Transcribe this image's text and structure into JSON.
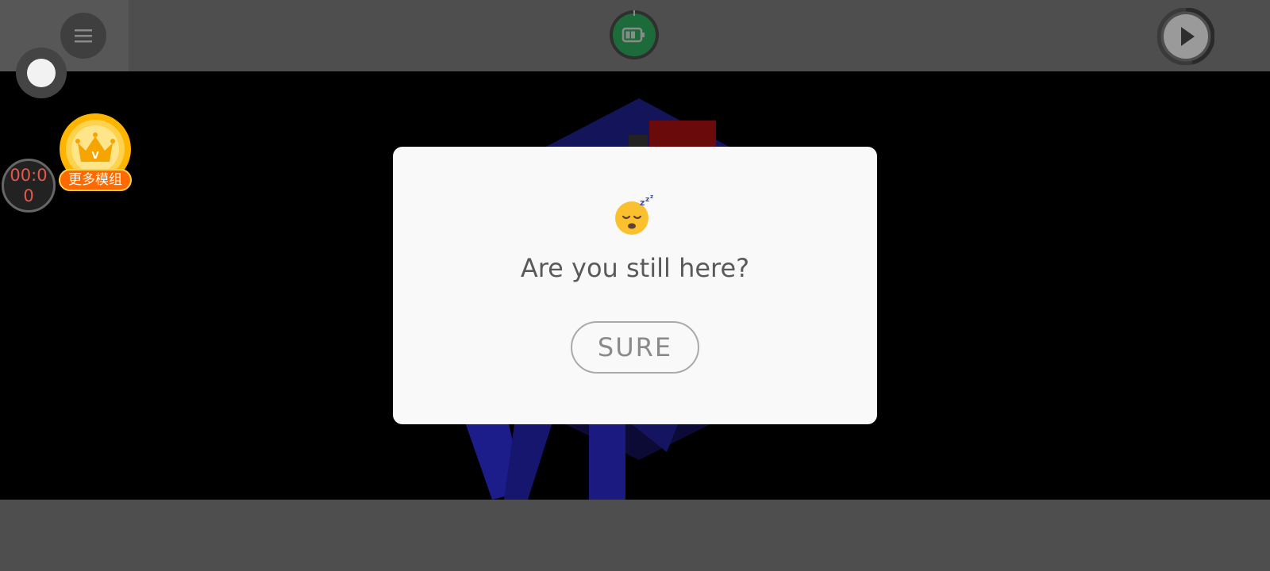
{
  "topbar": {
    "menu_icon": "menu-icon",
    "battery_icon": "battery-icon",
    "play_icon": "play-icon"
  },
  "timer": {
    "line1": "00:0",
    "line2": "0",
    "color": "#e8574a"
  },
  "vip": {
    "coin_letter": "V",
    "label": "更多模组"
  },
  "dialog": {
    "emoji_icon": "sleeping-face-icon",
    "title": "Are you still here?",
    "button_label": "SURE"
  },
  "colors": {
    "bar": "#4e4e4e",
    "dialog_bg": "#f9f9f9",
    "battery_ring": "#1d6b3a",
    "vip_orange": "#ff6a00"
  }
}
